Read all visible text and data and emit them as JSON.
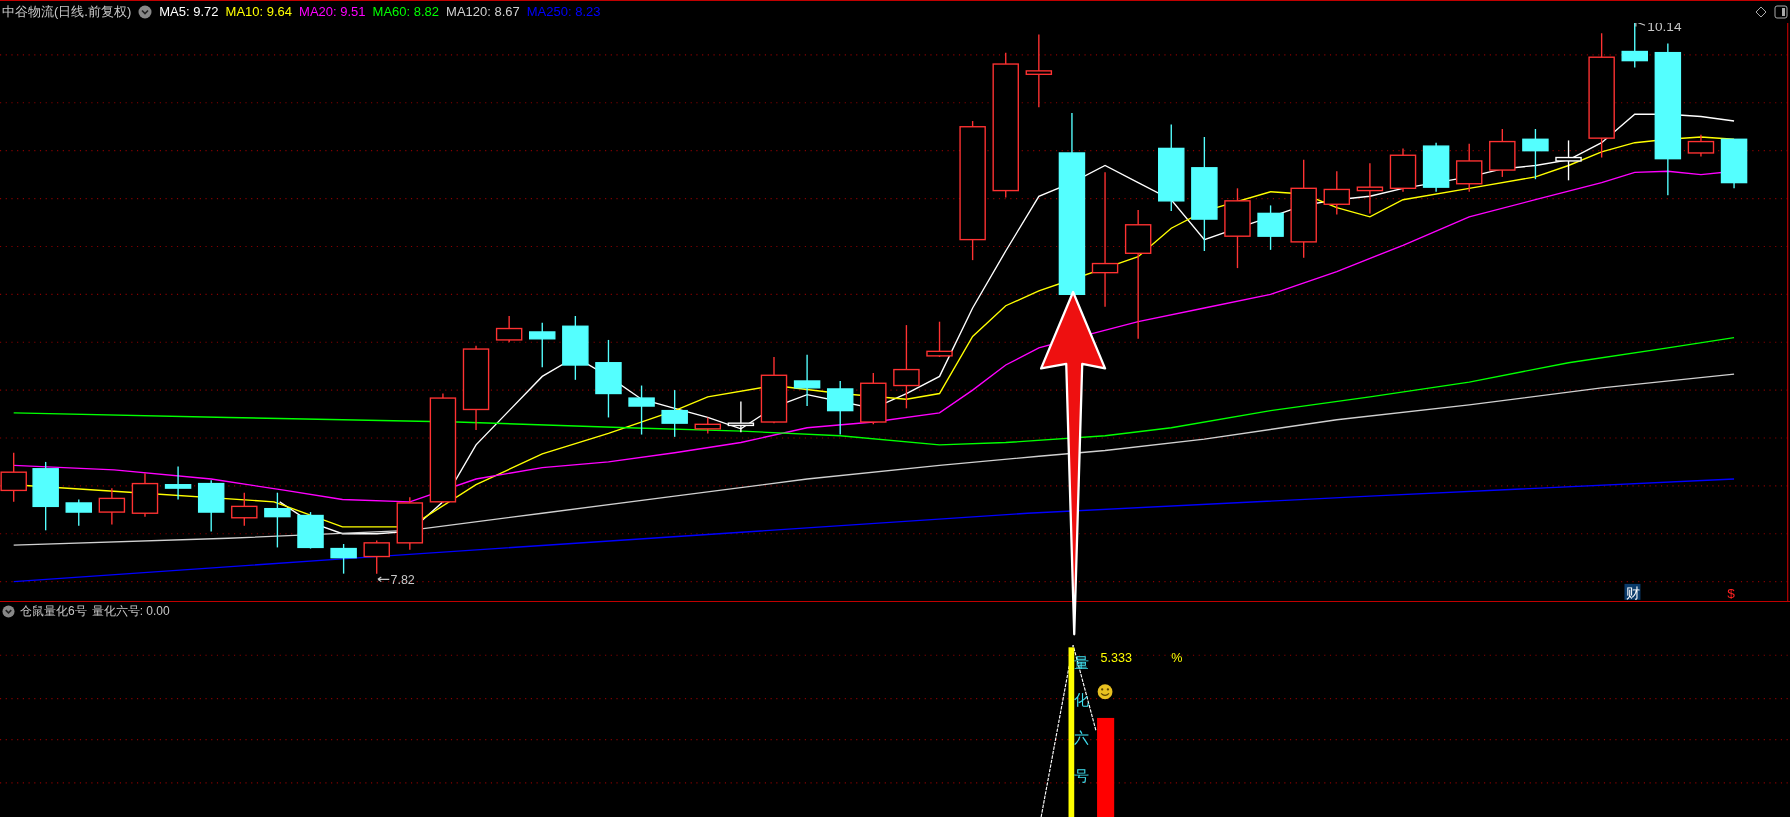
{
  "main_panel": {
    "title": "中谷物流(日线.前复权)",
    "ma_lines": [
      {
        "label": "MA5: 9.72",
        "color": "#ffffff"
      },
      {
        "label": "MA10: 9.64",
        "color": "#ffff00"
      },
      {
        "label": "MA20: 9.51",
        "color": "#ff00ff"
      },
      {
        "label": "MA60: 8.82",
        "color": "#00ff00"
      },
      {
        "label": "MA120: 8.67",
        "color": "#d0d0d0"
      },
      {
        "label": "MA250: 8.23",
        "color": "#0000ff"
      }
    ],
    "high_label": "10.14",
    "low_label": "7.82",
    "finance_badge": "财",
    "dollar_mark": "$"
  },
  "indicator_panel": {
    "name": "仓鼠量化6号",
    "value_label": "量化六号: 0.00",
    "vertical_text": "量化六号",
    "percent_value": "5.333",
    "percent_sign": "%"
  }
}
